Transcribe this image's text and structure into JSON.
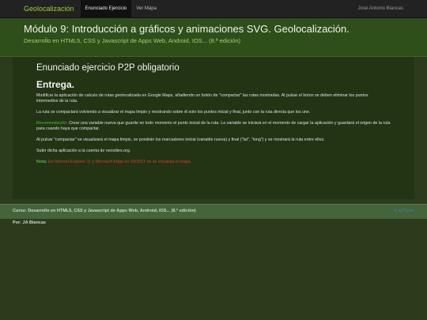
{
  "navbar": {
    "brand": "Geolocalización",
    "items": [
      {
        "label": "Enunciado Ejercicio",
        "active": true
      },
      {
        "label": "Ver Mapa",
        "active": false
      }
    ],
    "user": "José Antonio Blancas"
  },
  "header": {
    "title": "Módulo 9: Introducción a gráficos y animaciones SVG. Geolocalización.",
    "subtitle": "Desarrollo en HTML5, CSS y Javascript de Apps Web, Android, IOS... (8.ª edición)"
  },
  "main": {
    "heading": "Enunciado ejercicio P2P obligatorio",
    "section_title": "Entrega.",
    "p1": "Modificar la aplicación de calculo de rutas geolocalizada en Google Maps, añadiendo un botón de \"compactar\" las rutas mostradas. Al pulsar el boton se deben eliminar los puntos intermedios de la ruta.",
    "p2": "La ruta se compactará volviendo a visualizar el mapa limpio y mostrando sobre él solo los puntos inicial y final, junto con la ruta directa que los une.",
    "p3_label": "Recomendación:",
    "p3_text": " Crear una variable nueva que guarde en todo momento el punto inicial de la ruta. La variable se iniciará en el momento de cargar la aplicación y guardará el origen de la ruta para cuando haya que compactar.",
    "p4": "Al pulsar \"compactar\" se visualizará el mapa limpio, se pondrán los marcadores inicial (variable nueva) y final (\"lat\", \"long\") y se mostrará la ruta entre ellos.",
    "p5": "Subir dicha aplicación a la cuenta de neocities.org.",
    "note_label": "Nota:",
    "note_text": " En Internet Explorer 11 y Microsoft Edge en 10/2017 no se visualiza el mapa."
  },
  "footer": {
    "course": "Curso: Desarrollo en HTML5, CSS y Javascript de Apps Web, Android, IOS... (8.ª edición)",
    "back_link": "Ir al Curso",
    "author": "Por: JA Blancas"
  }
}
